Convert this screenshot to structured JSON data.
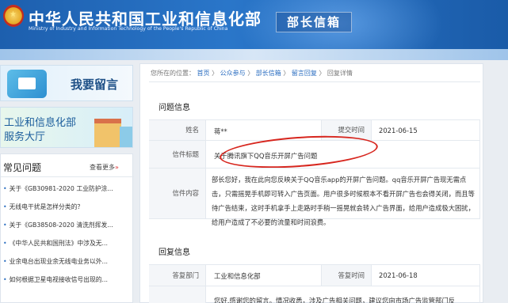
{
  "header": {
    "site_title": "中华人民共和国工业和信息化部",
    "site_subtitle": "Ministry of Industry and Information Technology of the People's Republic of China",
    "section_tag": "部长信箱",
    "emblem_glyph": "★"
  },
  "sidebar": {
    "card_message": "我要留言",
    "card_hall_line1": "工业和信息化部",
    "card_hall_line2": "服务大厅",
    "faq_title": "常见问题",
    "faq_more": "查看更多",
    "faq_more_icon": "»",
    "bullet": "•",
    "faq_items": [
      "关于《GB30981-2020 工业防护涂...",
      "无线电干扰是怎样分类的？",
      "关于《GB38508-2020 清洗剂挥发...",
      "《中华人民共和国刑法》中涉及无...",
      "业余电台出现业余无线电业务以外...",
      "如何根据卫星电视接收信号出现的..."
    ]
  },
  "breadcrumb": {
    "prefix": "您所在的位置：",
    "items": [
      "首页",
      "公众参与",
      "部长信箱",
      "留言回复",
      "回复详情"
    ],
    "sep": "〉"
  },
  "letter": {
    "section_title": "问题信息",
    "name_label": "姓名",
    "name_value": "蒋**",
    "submit_label": "提交时间",
    "submit_value": "2021-06-15",
    "subject_label": "信件标题",
    "subject_value": "关于腾讯旗下QQ音乐开屏广告问题",
    "content_label": "信件内容",
    "content_value": "部长您好，我在此向您反映关于QQ音乐app的开屏广告问题。qq音乐开屏广告现无需点击，只需摇晃手机即可转入广告页面。用户很多时候根本不看开屏广告也会得关闭，而且等待广告结束，这时手机拿手上走路时手稍一摇晃就会转入广告界面，给用户造成极大困扰，给用户造成了不必要的流量和时间浪费。"
  },
  "reply": {
    "section_title": "回复信息",
    "dept_label": "答复部门",
    "dept_value": "工业和信息化部",
    "date_label": "答复时间",
    "date_value": "2021-06-18",
    "preview": "您好,感谢您的留言。情况收悉，涉及广告相关问题，建议您向市场广告监管部门反"
  },
  "colors": {
    "banner": "#1d5fae",
    "link": "#2a6dc0",
    "highlight_ellipse": "#d7261e"
  }
}
